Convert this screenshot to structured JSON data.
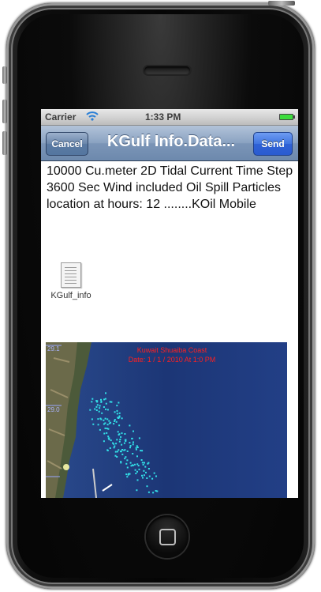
{
  "status_bar": {
    "carrier": "Carrier",
    "wifi_icon": "wifi-icon",
    "time": "1:33 PM",
    "battery_icon": "battery-icon"
  },
  "nav_bar": {
    "cancel_label": "Cancel",
    "title": "KGulf Info.Data...",
    "send_label": "Send"
  },
  "message": {
    "body": "10000 Cu.meter 2D Tidal Current Time Step 3600 Sec Wind included Oil Spill Particles location at hours: 12 ........KOil Mobile"
  },
  "attachment": {
    "icon": "document-icon",
    "filename": "KGulf_info"
  },
  "embedded_image": {
    "title_line1": "Kuwait Shuaiba Coast",
    "title_line2": "Date: 1 / 1 / 2010 At 1:0 PM",
    "axis_labels": [
      "29.1",
      "29.0"
    ]
  },
  "colors": {
    "nav_bar": "#7b95b7",
    "send_button": "#3f74e0",
    "map_sea": "#1d3a7a",
    "particles": "#32e0e8",
    "map_title": "#ff2020"
  }
}
